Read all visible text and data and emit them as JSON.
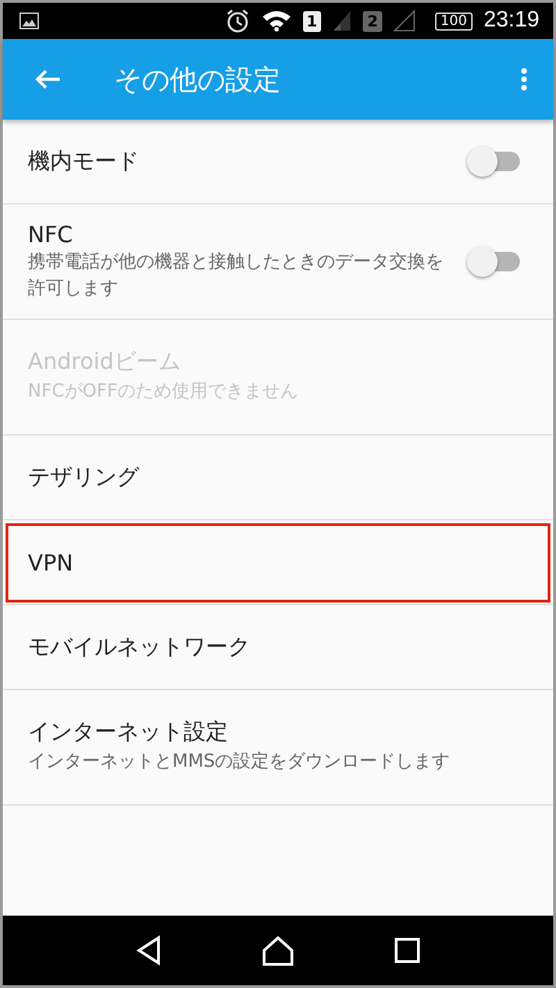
{
  "status_bar": {
    "sim_1": "1",
    "sim_2": "2",
    "battery": "100",
    "time": "23:19"
  },
  "app_bar": {
    "title": "その他の設定"
  },
  "items": [
    {
      "kind": "toggle",
      "title": "機内モード",
      "on": false,
      "disabled": false,
      "highlighted": false
    },
    {
      "kind": "toggle",
      "title": "NFC",
      "summary": "携帯電話が他の機器と接触したときのデータ交換を許可します",
      "on": false,
      "disabled": false,
      "highlighted": false
    },
    {
      "kind": "plain",
      "title": "Androidビーム",
      "summary": "NFCがOFFのため使用できません",
      "disabled": true,
      "highlighted": false
    },
    {
      "kind": "plain",
      "title": "テザリング",
      "disabled": false,
      "highlighted": false
    },
    {
      "kind": "plain",
      "title": "VPN",
      "disabled": false,
      "highlighted": true
    },
    {
      "kind": "plain",
      "title": "モバイルネットワーク",
      "disabled": false,
      "highlighted": false
    },
    {
      "kind": "plain",
      "title": "インターネット設定",
      "summary": "インターネットとMMSの設定をダウンロードします",
      "disabled": false,
      "highlighted": false
    }
  ]
}
